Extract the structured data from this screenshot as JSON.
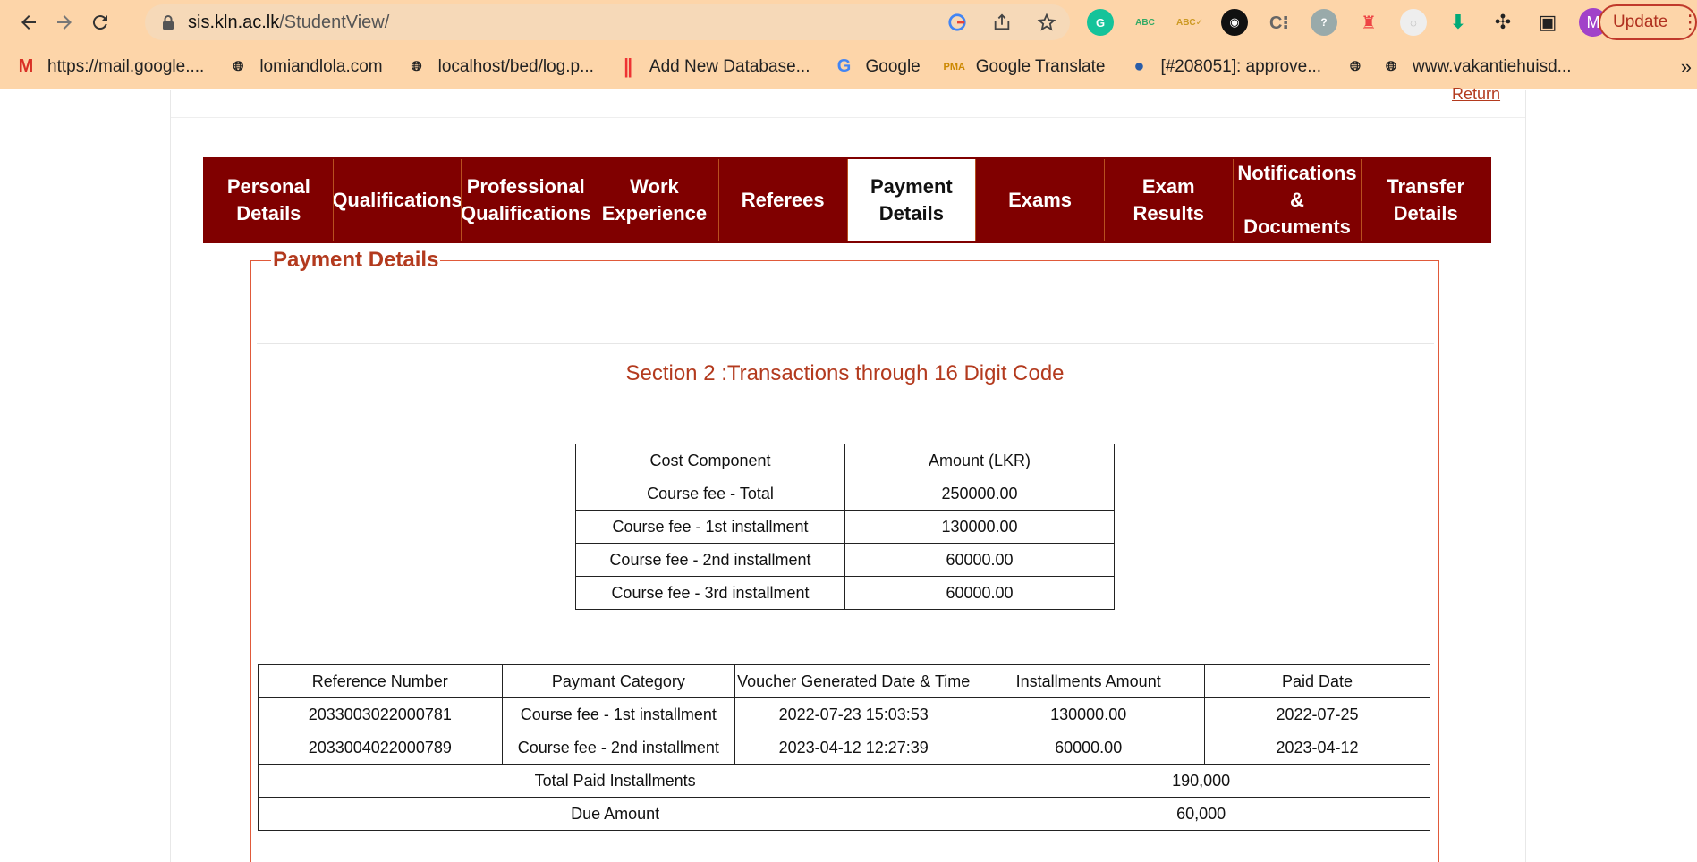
{
  "browser": {
    "url_host": "sis.kln.ac.lk",
    "url_path": "/StudentView/",
    "profile_initial": "M",
    "update_label": "Update",
    "bookmarks": [
      {
        "label": "https://mail.google....",
        "icon": "gmail-icon"
      },
      {
        "label": "lomiandlola.com",
        "icon": "globe-icon"
      },
      {
        "label": "localhost/bed/log.p...",
        "icon": "globe-icon"
      },
      {
        "label": "Add New Database...",
        "icon": "database-icon"
      },
      {
        "label": "Google",
        "icon": "google-icon"
      },
      {
        "label": "Google Translate",
        "icon": "pma-icon"
      },
      {
        "label": "[#208051]: approve...",
        "icon": "drupal-icon"
      },
      {
        "label": "",
        "icon": "globe-icon"
      },
      {
        "label": "www.vakantiehuisd...",
        "icon": "globe-icon"
      }
    ],
    "more_label": "»"
  },
  "page": {
    "return_label": "Return",
    "tabs": [
      {
        "label": "Personal\nDetails",
        "active": false
      },
      {
        "label": "Qualifications",
        "active": false
      },
      {
        "label": "Professional\nQualifications",
        "active": false
      },
      {
        "label": "Work\nExperience",
        "active": false
      },
      {
        "label": "Referees",
        "active": false
      },
      {
        "label": "Payment\nDetails",
        "active": true
      },
      {
        "label": "Exams",
        "active": false
      },
      {
        "label": "Exam\nResults",
        "active": false
      },
      {
        "label": "Notifications\n&\nDocuments",
        "active": false
      },
      {
        "label": "Transfer\nDetails",
        "active": false
      }
    ],
    "legend": "Payment Details",
    "section_title": "Section 2 :Transactions through 16 Digit Code",
    "cost_table": {
      "headers": [
        "Cost Component",
        "Amount (LKR)"
      ],
      "rows": [
        [
          "Course fee - Total",
          "250000.00"
        ],
        [
          "Course fee - 1st installment",
          "130000.00"
        ],
        [
          "Course fee - 2nd installment",
          "60000.00"
        ],
        [
          "Course fee - 3rd installment",
          "60000.00"
        ]
      ]
    },
    "payment_table": {
      "headers": [
        "Reference Number",
        "Paymant Category",
        "Voucher Generated Date & Time",
        "Installments Amount",
        "Paid Date"
      ],
      "rows": [
        [
          "2033003022000781",
          "Course fee - 1st installment",
          "2022-07-23 15:03:53",
          "130000.00",
          "2022-07-25"
        ],
        [
          "2033004022000789",
          "Course fee - 2nd installment",
          "2023-04-12 12:27:39",
          "60000.00",
          "2023-04-12"
        ]
      ],
      "total_paid_label": "Total Paid Installments",
      "total_paid_value": "190,000",
      "due_label": "Due Amount",
      "due_value": "60,000"
    }
  },
  "colors": {
    "tab_bg": "#800000",
    "accent_text": "#b33a1e",
    "chrome_bg": "#fdd5a9"
  }
}
